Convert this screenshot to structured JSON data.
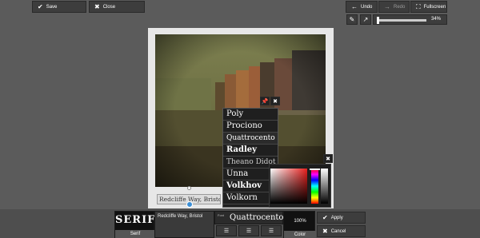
{
  "toolbar": {
    "save_label": "Save",
    "close_label": "Close",
    "undo_label": "Undo",
    "redo_label": "Redo",
    "fullscreen_label": "Fullscreen",
    "zoom_value": "34%",
    "zoom_level": 0.34
  },
  "canvas": {
    "caption_text": "Redcliffe Way, Bristol",
    "photo_description_icon": "canal-photo"
  },
  "font_list": {
    "items": [
      "Poly",
      "Prociono",
      "Quattrocento",
      "Radley",
      "Theano Didot",
      "Unna",
      "Volkhov",
      "Volkorn"
    ]
  },
  "bottom": {
    "preview_text": "SERIF",
    "preview_label": "Serif",
    "text_value": "Redcliffe Way, Bristol",
    "font_label": "Font",
    "font_value": "Quattrocento",
    "opacity_value": "100%",
    "color_label": "Color",
    "apply_label": "Apply",
    "cancel_label": "Cancel"
  },
  "colors": {
    "background": "#5b5b5b",
    "panel": "#2b2b2b",
    "frame": "#e7e7e7",
    "handle_blue": "#3b8fd6"
  }
}
